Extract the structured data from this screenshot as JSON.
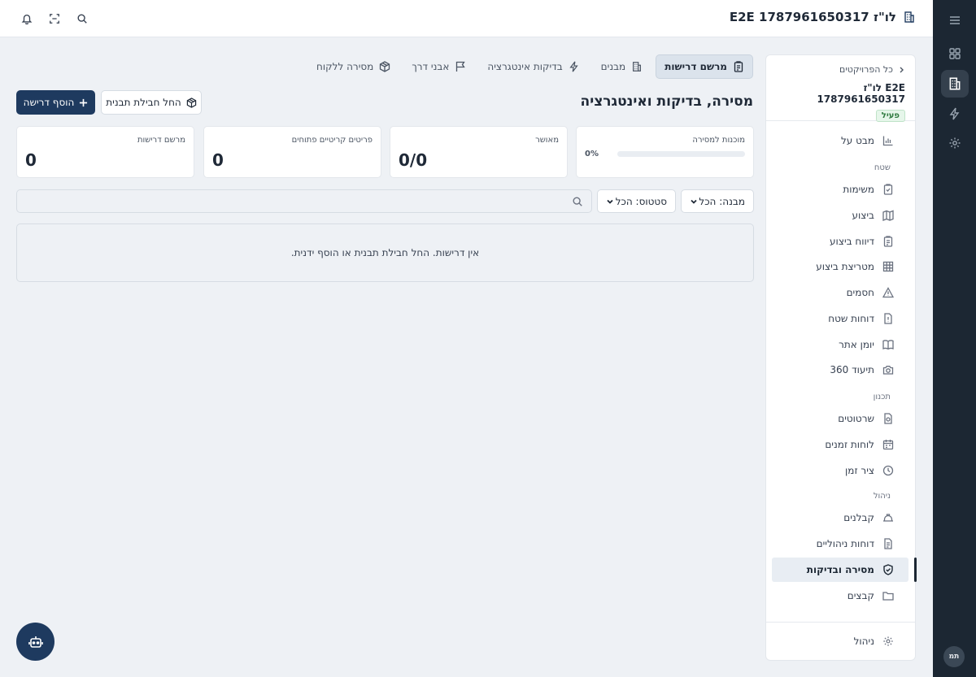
{
  "topbar": {
    "project_title": "E2E לו\"ז 1787961650317",
    "icons": [
      "bell-icon",
      "scan-icon",
      "search-icon"
    ]
  },
  "rail": {
    "icons": [
      "menu-icon",
      "dashboard-icon",
      "building-icon",
      "lightning-icon",
      "settings-icon"
    ],
    "user_initials": "תמ"
  },
  "sidebar": {
    "back_label": "כל הפרויקטים",
    "project_name": "E2E לו\"ז 1787961650317",
    "status_badge": "פעיל",
    "overview": "מבט על",
    "section_field": "שטח",
    "items_field": [
      "משימות",
      "ביצוע",
      "דיווח ביצוע",
      "מטריצת ביצוע",
      "חסמים",
      "דוחות שטח",
      "יומן אתר",
      "תיעוד 360"
    ],
    "section_planning": "תכנון",
    "items_planning": [
      "שרטוטים",
      "לוחות זמנים",
      "ציר זמן"
    ],
    "section_management": "ניהול",
    "items_management": [
      "קבלנים",
      "דוחות ניהוליים",
      "מסירה ובדיקות",
      "קבצים"
    ],
    "admin": "ניהול"
  },
  "tabs": [
    "מרשם דרישות",
    "מבנים",
    "בדיקות אינטגרציה",
    "אבני דרך",
    "מסירה ללקוח"
  ],
  "page": {
    "title": "מסירה, בדיקות ואינטגרציה",
    "add_button": "הוסף דרישה",
    "template_button": "החל חבילת תבנית"
  },
  "stats": {
    "readiness_label": "מוכנות למסירה",
    "readiness_pct": "0%",
    "readiness_value": 0,
    "approved_label": "מאושר",
    "approved_value": "0/0",
    "critical_label": "פריטים קריטיים פתוחים",
    "critical_value": "0",
    "registry_label": "מרשם דרישות",
    "registry_value": "0"
  },
  "filters": {
    "building": "מבנה: הכל",
    "status": "סטטוס: הכל",
    "search_placeholder": ""
  },
  "empty_message": "אין דרישות. החל חבילת תבנית או הוסף ידנית.",
  "colors": {
    "primary": "#1e3a5f",
    "rail": "#1c2733",
    "badge_green": "#2f7a3f"
  }
}
